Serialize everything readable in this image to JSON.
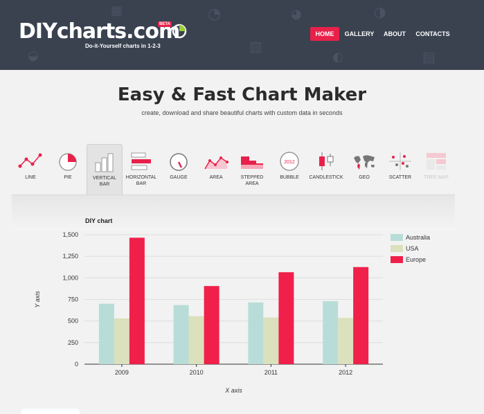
{
  "header": {
    "logo_text": "DIYcharts.com",
    "badge": "BETA",
    "tagline": "Do-it-Yourself charts in 1-2-3",
    "nav": [
      {
        "label": "HOME",
        "active": true
      },
      {
        "label": "GALLERY",
        "active": false
      },
      {
        "label": "ABOUT",
        "active": false
      },
      {
        "label": "CONTACTS",
        "active": false
      }
    ],
    "brand_color": "#e8214a"
  },
  "hero": {
    "title": "Easy & Fast Chart Maker",
    "subtitle": "create, download and share beautiful charts with custom data in seconds"
  },
  "chart_types": [
    {
      "label": "LINE",
      "icon": "line-chart-icon"
    },
    {
      "label": "PIE",
      "icon": "pie-chart-icon"
    },
    {
      "label": "VERTICAL BAR",
      "icon": "vertical-bar-icon",
      "active": true
    },
    {
      "label": "HORIZONTAL BAR",
      "icon": "horizontal-bar-icon"
    },
    {
      "label": "GAUGE",
      "icon": "gauge-icon"
    },
    {
      "label": "AREA",
      "icon": "area-chart-icon"
    },
    {
      "label": "STEPPED AREA",
      "icon": "stepped-area-icon"
    },
    {
      "label": "BUBBLE",
      "icon": "bubble-icon",
      "icon_text": "2012"
    },
    {
      "label": "CANDLESTICK",
      "icon": "candlestick-icon"
    },
    {
      "label": "GEO",
      "icon": "world-map-icon"
    },
    {
      "label": "SCATTER",
      "icon": "scatter-icon"
    },
    {
      "label": "TREE MAP",
      "icon": "tree-map-icon",
      "disabled": true
    }
  ],
  "chart_data": {
    "type": "bar",
    "title": "DIY chart",
    "xlabel": "X axis",
    "ylabel": "Y axis",
    "categories": [
      "2009",
      "2010",
      "2011",
      "2012"
    ],
    "series": [
      {
        "name": "Australia",
        "color": "#b8ddd8",
        "values": [
          700,
          685,
          715,
          730
        ]
      },
      {
        "name": "USA",
        "color": "#dbe0bd",
        "values": [
          530,
          555,
          540,
          535
        ]
      },
      {
        "name": "Europe",
        "color": "#f0204a",
        "values": [
          1465,
          905,
          1065,
          1125
        ]
      }
    ],
    "ylim": [
      0,
      1500
    ],
    "yticks": [
      "0",
      "250",
      "500",
      "750",
      "1,000",
      "1,250",
      "1,500"
    ],
    "grid": true,
    "legend": "right"
  }
}
